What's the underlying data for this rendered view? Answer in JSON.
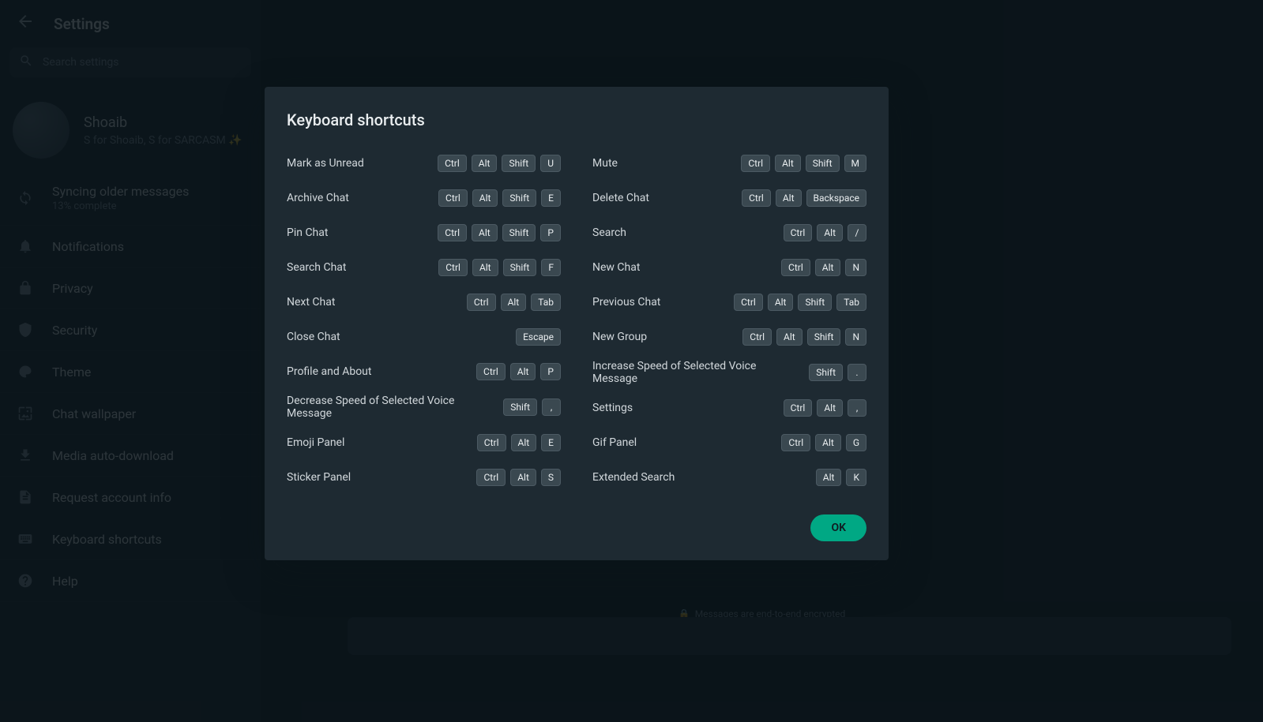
{
  "header": {
    "title": "Settings"
  },
  "search": {
    "placeholder": "Search settings"
  },
  "profile": {
    "name": "Shoaib",
    "status": "S for Shoaib, S for SARCASM ✨"
  },
  "settings_items": [
    {
      "icon": "sync",
      "label": "Syncing older messages",
      "sub": "13% complete"
    },
    {
      "icon": "bell",
      "label": "Notifications",
      "sub": ""
    },
    {
      "icon": "lock",
      "label": "Privacy",
      "sub": ""
    },
    {
      "icon": "shield",
      "label": "Security",
      "sub": ""
    },
    {
      "icon": "palette",
      "label": "Theme",
      "sub": ""
    },
    {
      "icon": "wallpaper",
      "label": "Chat wallpaper",
      "sub": ""
    },
    {
      "icon": "download",
      "label": "Media auto-download",
      "sub": ""
    },
    {
      "icon": "document",
      "label": "Request account info",
      "sub": ""
    },
    {
      "icon": "keyboard",
      "label": "Keyboard shortcuts",
      "sub": ""
    },
    {
      "icon": "help",
      "label": "Help",
      "sub": ""
    }
  ],
  "encryption": {
    "text": "Messages are end-to-end encrypted"
  },
  "modal": {
    "title": "Keyboard shortcuts",
    "ok_label": "OK",
    "left": [
      {
        "label": "Mark as Unread",
        "keys": [
          "Ctrl",
          "Alt",
          "Shift",
          "U"
        ]
      },
      {
        "label": "Archive Chat",
        "keys": [
          "Ctrl",
          "Alt",
          "Shift",
          "E"
        ]
      },
      {
        "label": "Pin Chat",
        "keys": [
          "Ctrl",
          "Alt",
          "Shift",
          "P"
        ]
      },
      {
        "label": "Search Chat",
        "keys": [
          "Ctrl",
          "Alt",
          "Shift",
          "F"
        ]
      },
      {
        "label": "Next Chat",
        "keys": [
          "Ctrl",
          "Alt",
          "Tab"
        ]
      },
      {
        "label": "Close Chat",
        "keys": [
          "Escape"
        ]
      },
      {
        "label": "Profile and About",
        "keys": [
          "Ctrl",
          "Alt",
          "P"
        ]
      },
      {
        "label": "Decrease Speed of Selected Voice Message",
        "keys": [
          "Shift",
          ","
        ]
      },
      {
        "label": "Emoji Panel",
        "keys": [
          "Ctrl",
          "Alt",
          "E"
        ]
      },
      {
        "label": "Sticker Panel",
        "keys": [
          "Ctrl",
          "Alt",
          "S"
        ]
      }
    ],
    "right": [
      {
        "label": "Mute",
        "keys": [
          "Ctrl",
          "Alt",
          "Shift",
          "M"
        ]
      },
      {
        "label": "Delete Chat",
        "keys": [
          "Ctrl",
          "Alt",
          "Backspace"
        ]
      },
      {
        "label": "Search",
        "keys": [
          "Ctrl",
          "Alt",
          "/"
        ]
      },
      {
        "label": "New Chat",
        "keys": [
          "Ctrl",
          "Alt",
          "N"
        ]
      },
      {
        "label": "Previous Chat",
        "keys": [
          "Ctrl",
          "Alt",
          "Shift",
          "Tab"
        ]
      },
      {
        "label": "New Group",
        "keys": [
          "Ctrl",
          "Alt",
          "Shift",
          "N"
        ]
      },
      {
        "label": "Increase Speed of Selected Voice Message",
        "keys": [
          "Shift",
          "."
        ]
      },
      {
        "label": "Settings",
        "keys": [
          "Ctrl",
          "Alt",
          ","
        ]
      },
      {
        "label": "Gif Panel",
        "keys": [
          "Ctrl",
          "Alt",
          "G"
        ]
      },
      {
        "label": "Extended Search",
        "keys": [
          "Alt",
          "K"
        ]
      }
    ]
  }
}
